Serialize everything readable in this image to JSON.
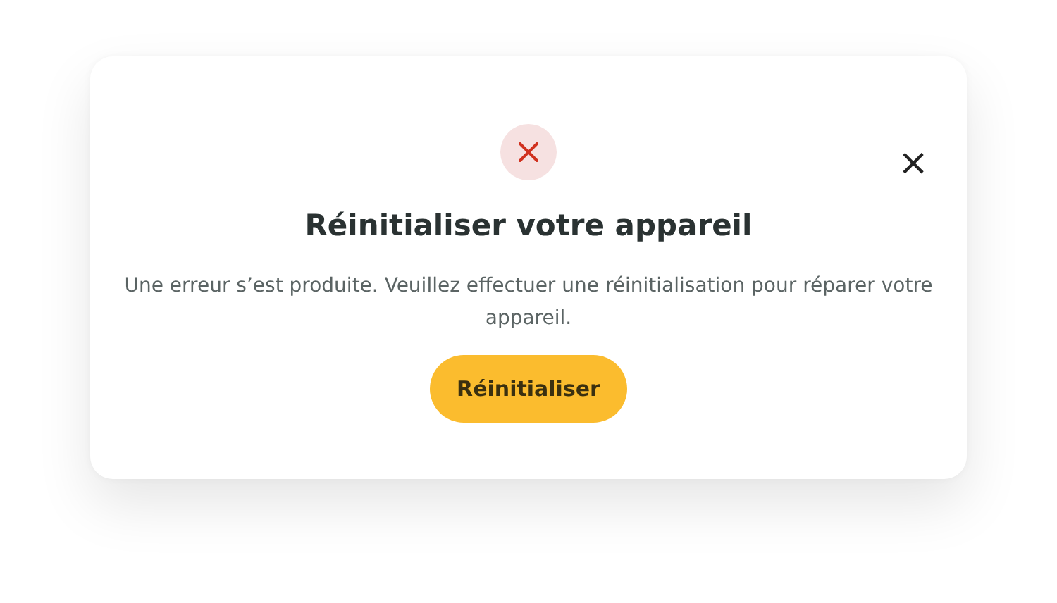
{
  "dialog": {
    "close": "×",
    "title": "Réinitialiser votre appareil",
    "message": "Une erreur s’est produite. Veuillez effectuer une réinitialisation pour réparer votre appareil.",
    "button": "Réinitialiser"
  }
}
